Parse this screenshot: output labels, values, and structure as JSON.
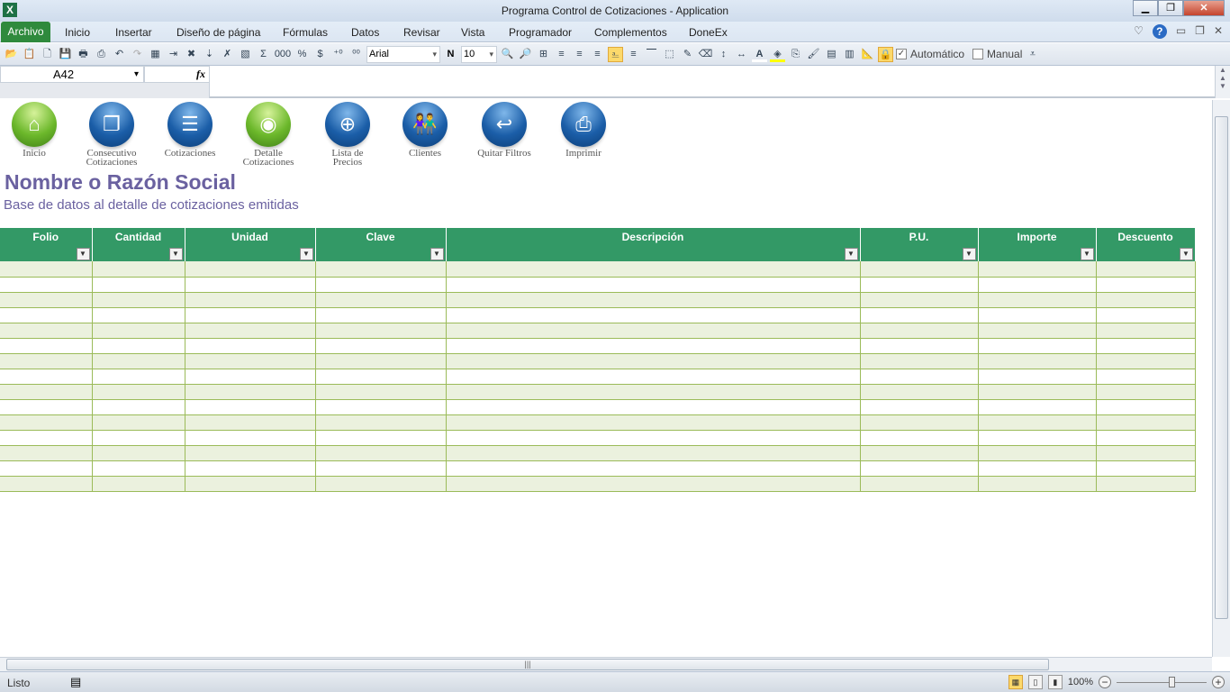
{
  "window": {
    "title": "Programa Control de Cotizaciones - Application",
    "app_icon": "X"
  },
  "menu": {
    "archivo": "Archivo",
    "items": [
      "Inicio",
      "Insertar",
      "Diseño de página",
      "Fórmulas",
      "Datos",
      "Revisar",
      "Vista",
      "Programador",
      "Complementos",
      "DoneEx"
    ]
  },
  "toolbar": {
    "font": "Arial",
    "size": "10",
    "bold": "N",
    "auto_label": "Automático",
    "manual_label": "Manual",
    "sum": "Σ",
    "thousands": "000",
    "percent": "%",
    "currency": "$"
  },
  "formula_bar": {
    "name_box": "A42",
    "fx": "fx",
    "value": ""
  },
  "nav_buttons": [
    {
      "label": "Inicio",
      "color": "green",
      "icon": "home-icon",
      "glyph": "⌂"
    },
    {
      "label": "Consecutivo Cotizaciones",
      "color": "blue",
      "icon": "documents-icon",
      "glyph": "❐"
    },
    {
      "label": "Cotizaciones",
      "color": "blue",
      "icon": "document-icon",
      "glyph": "☰"
    },
    {
      "label": "Detalle Cotizaciones",
      "color": "green",
      "icon": "disc-icon",
      "glyph": "◉"
    },
    {
      "label": "Lista de Precios",
      "color": "blue",
      "icon": "target-icon",
      "glyph": "⊕"
    },
    {
      "label": "Clientes",
      "color": "blue",
      "icon": "people-icon",
      "glyph": "👫"
    },
    {
      "label": "Quitar Filtros",
      "color": "blue",
      "icon": "undo-arrow-icon",
      "glyph": "↩"
    },
    {
      "label": "Imprimir",
      "color": "blue",
      "icon": "printer-icon",
      "glyph": "⎙"
    }
  ],
  "heading": {
    "title": "Nombre o Razón Social",
    "subtitle": "Base de datos al detalle de cotizaciones emitidas"
  },
  "table": {
    "columns": [
      "Folio",
      "Cantidad",
      "Unidad",
      "Clave",
      "Descripción",
      "P.U.",
      "Importe",
      "Descuento"
    ],
    "row_count": 15
  },
  "status": {
    "ready": "Listo",
    "zoom": "100%"
  },
  "colors": {
    "header_green": "#339966",
    "band": "#ebf1de",
    "title_purple": "#6a61a0"
  }
}
